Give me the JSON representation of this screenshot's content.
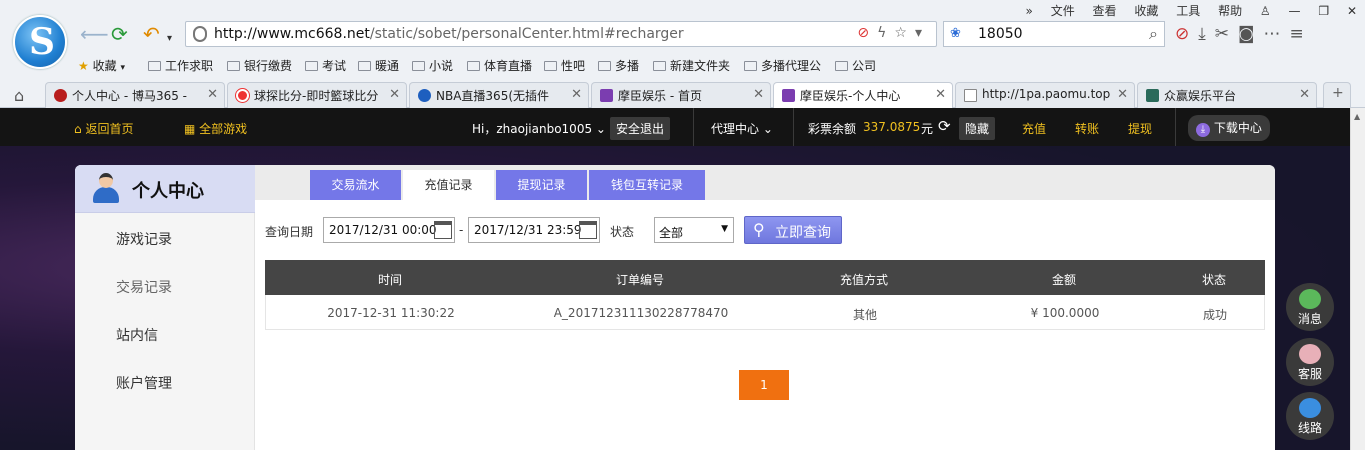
{
  "browser": {
    "menu": [
      "文件",
      "查看",
      "收藏",
      "工具",
      "帮助"
    ],
    "url_domain": "http://www.mc668.net",
    "url_path": "/static/sobet/personalCenter.html#recharger",
    "search_value": "18050",
    "bookmarks": [
      "收藏",
      "工作求职",
      "银行缴费",
      "考试",
      "暖通",
      "小说",
      "体育直播",
      "性吧",
      "多播",
      "新建文件夹",
      "多播代理公",
      "公司"
    ],
    "tabs": [
      "个人中心 - 博马365 - ",
      "球探比分-即时籃球比分",
      "NBA直播365(无插件",
      "摩臣娱乐 - 首页",
      "摩臣娱乐-个人中心",
      "http://1pa.paomu.top",
      "众赢娱乐平台"
    ]
  },
  "sitebar": {
    "home": "返回首页",
    "all_games": "全部游戏",
    "greeting": "Hi，zhaojianbo1005",
    "logout": "安全退出",
    "agent": "代理中心",
    "balance_label": "彩票余额",
    "balance_value": "337.0875",
    "currency": "元",
    "hide": "隐藏",
    "recharge": "充值",
    "transfer": "转账",
    "withdraw": "提现",
    "download": "下载中心"
  },
  "sidebar": {
    "title": "个人中心",
    "items": [
      "游戏记录",
      "交易记录",
      "站内信",
      "账户管理"
    ]
  },
  "tabs": [
    "交易流水",
    "充值记录",
    "提现记录",
    "钱包互转记录"
  ],
  "filter": {
    "date_label": "查询日期",
    "start": "2017/12/31 00:00",
    "dash": "-",
    "end": "2017/12/31 23:59",
    "status_label": "状态",
    "status_value": "全部",
    "query_btn": "立即查询"
  },
  "table": {
    "headers": [
      "时间",
      "订单编号",
      "充值方式",
      "金额",
      "状态"
    ],
    "rows": [
      [
        "2017-12-31 11:30:22",
        "A_201712311130228778470",
        "其他",
        "¥ 100.0000",
        "成功"
      ]
    ]
  },
  "pager": {
    "current": "1"
  },
  "float": [
    "消息",
    "客服",
    "线路"
  ],
  "colors": {
    "tab_purple": "#7477e8",
    "accent_orange": "#f07010",
    "gold": "#f0c020"
  }
}
